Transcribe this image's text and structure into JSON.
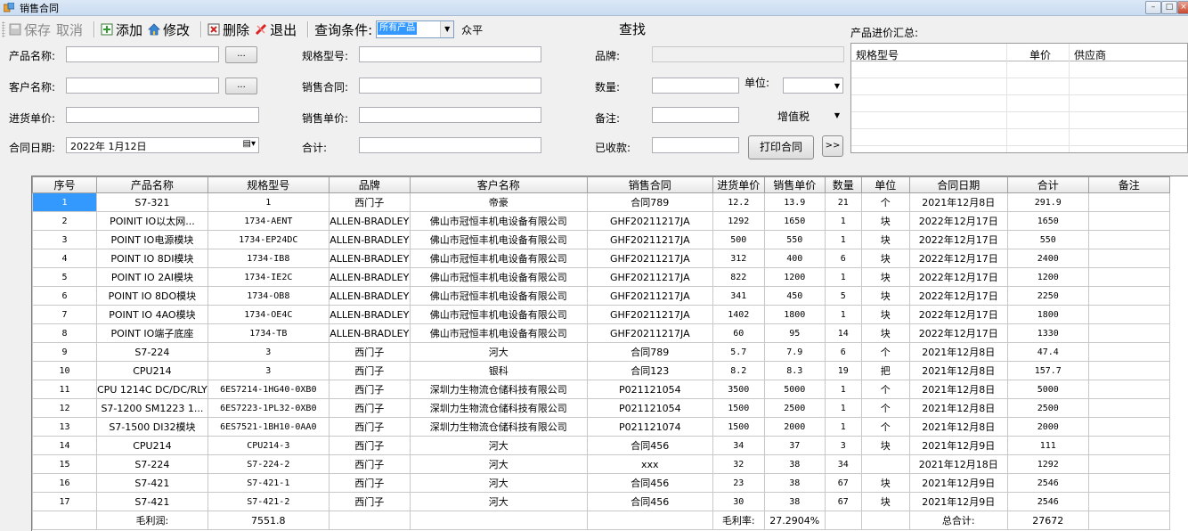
{
  "window": {
    "title": "销售合同",
    "controls": [
      "–",
      "□",
      "×"
    ]
  },
  "toolbar": {
    "save": "保存",
    "cancel": "取消",
    "add": "添加",
    "edit": "修改",
    "delete": "删除",
    "exit": "退出",
    "query_label": "查询条件:",
    "query_value": "所有产品",
    "query_text": "众平",
    "find": "查找"
  },
  "summary": {
    "title": "产品进价汇总:",
    "col_model": "规格型号",
    "col_price": "单价",
    "col_supplier": "供应商"
  },
  "form": {
    "product_name": "产品名称:",
    "customer_name": "客户名称:",
    "purchase_price": "进货单价:",
    "contract_date": "合同日期:",
    "contract_date_value": "2022年 1月12日",
    "model": "规格型号:",
    "sales_contract": "销售合同:",
    "sales_price": "销售单价:",
    "total": "合计:",
    "brand": "品牌:",
    "quantity": "数量:",
    "note": "备注:",
    "received": "已收款:",
    "unit": "单位:",
    "unit_value": "",
    "tax_value": "增值税",
    "dots": "...",
    "print_button": "打印合同",
    "more_button": ">>"
  },
  "grid": {
    "columns": [
      "序号",
      "产品名称",
      "规格型号",
      "品牌",
      "客户名称",
      "销售合同",
      "进货单价",
      "销售单价",
      "数量",
      "单位",
      "合同日期",
      "合计",
      "备注"
    ],
    "rows": [
      [
        "1",
        "S7-321",
        "1",
        "西门子",
        "帝豪",
        "合同789",
        "12.2",
        "13.9",
        "21",
        "个",
        "2021年12月8日",
        "291.9",
        ""
      ],
      [
        "2",
        "POINIT IO以太网...",
        "1734-AENT",
        "ALLEN-BRADLEY",
        "佛山市冠恒丰机电设备有限公司",
        "GHF20211217JA",
        "1292",
        "1650",
        "1",
        "块",
        "2022年12月17日",
        "1650",
        ""
      ],
      [
        "3",
        "POINT IO电源模块",
        "1734-EP24DC",
        "ALLEN-BRADLEY",
        "佛山市冠恒丰机电设备有限公司",
        "GHF20211217JA",
        "500",
        "550",
        "1",
        "块",
        "2022年12月17日",
        "550",
        ""
      ],
      [
        "4",
        "POINT IO 8DI模块",
        "1734-IB8",
        "ALLEN-BRADLEY",
        "佛山市冠恒丰机电设备有限公司",
        "GHF20211217JA",
        "312",
        "400",
        "6",
        "块",
        "2022年12月17日",
        "2400",
        ""
      ],
      [
        "5",
        "POINT IO 2AI模块",
        "1734-IE2C",
        "ALLEN-BRADLEY",
        "佛山市冠恒丰机电设备有限公司",
        "GHF20211217JA",
        "822",
        "1200",
        "1",
        "块",
        "2022年12月17日",
        "1200",
        ""
      ],
      [
        "6",
        "POINT IO 8DO模块",
        "1734-OB8",
        "ALLEN-BRADLEY",
        "佛山市冠恒丰机电设备有限公司",
        "GHF20211217JA",
        "341",
        "450",
        "5",
        "块",
        "2022年12月17日",
        "2250",
        ""
      ],
      [
        "7",
        "POINT IO 4AO模块",
        "1734-OE4C",
        "ALLEN-BRADLEY",
        "佛山市冠恒丰机电设备有限公司",
        "GHF20211217JA",
        "1402",
        "1800",
        "1",
        "块",
        "2022年12月17日",
        "1800",
        ""
      ],
      [
        "8",
        "POINT IO端子底座",
        "1734-TB",
        "ALLEN-BRADLEY",
        "佛山市冠恒丰机电设备有限公司",
        "GHF20211217JA",
        "60",
        "95",
        "14",
        "块",
        "2022年12月17日",
        "1330",
        ""
      ],
      [
        "9",
        "S7-224",
        "3",
        "西门子",
        "河大",
        "合同789",
        "5.7",
        "7.9",
        "6",
        "个",
        "2021年12月8日",
        "47.4",
        ""
      ],
      [
        "10",
        "CPU214",
        "3",
        "西门子",
        "银科",
        "合同123",
        "8.2",
        "8.3",
        "19",
        "把",
        "2021年12月8日",
        "157.7",
        ""
      ],
      [
        "11",
        "CPU 1214C DC/DC/RLY",
        "6ES7214-1HG40-0XB0",
        "西门子",
        "深圳力生物流仓储科技有限公司",
        "P021121054",
        "3500",
        "5000",
        "1",
        "个",
        "2021年12月8日",
        "5000",
        ""
      ],
      [
        "12",
        "S7-1200 SM1223 1...",
        "6ES7223-1PL32-0XB0",
        "西门子",
        "深圳力生物流仓储科技有限公司",
        "P021121054",
        "1500",
        "2500",
        "1",
        "个",
        "2021年12月8日",
        "2500",
        ""
      ],
      [
        "13",
        "S7-1500 DI32模块",
        "6ES7521-1BH10-0AA0",
        "西门子",
        "深圳力生物流仓储科技有限公司",
        "P021121074",
        "1500",
        "2000",
        "1",
        "个",
        "2021年12月8日",
        "2000",
        ""
      ],
      [
        "14",
        "CPU214",
        "CPU214-3",
        "西门子",
        "河大",
        "合同456",
        "34",
        "37",
        "3",
        "块",
        "2021年12月9日",
        "111",
        ""
      ],
      [
        "15",
        "S7-224",
        "S7-224-2",
        "西门子",
        "河大",
        "xxx",
        "32",
        "38",
        "34",
        "",
        "2021年12月18日",
        "1292",
        ""
      ],
      [
        "16",
        "S7-421",
        "S7-421-1",
        "西门子",
        "河大",
        "合同456",
        "23",
        "38",
        "67",
        "块",
        "2021年12月9日",
        "2546",
        ""
      ],
      [
        "17",
        "S7-421",
        "S7-421-2",
        "西门子",
        "河大",
        "合同456",
        "30",
        "38",
        "67",
        "块",
        "2021年12月9日",
        "2546",
        ""
      ]
    ],
    "footer": [
      "",
      "毛利润:",
      "7551.8",
      "",
      "",
      "",
      "毛利率:",
      "27.2904%",
      "",
      "",
      "总合计:",
      "27672",
      ""
    ]
  }
}
